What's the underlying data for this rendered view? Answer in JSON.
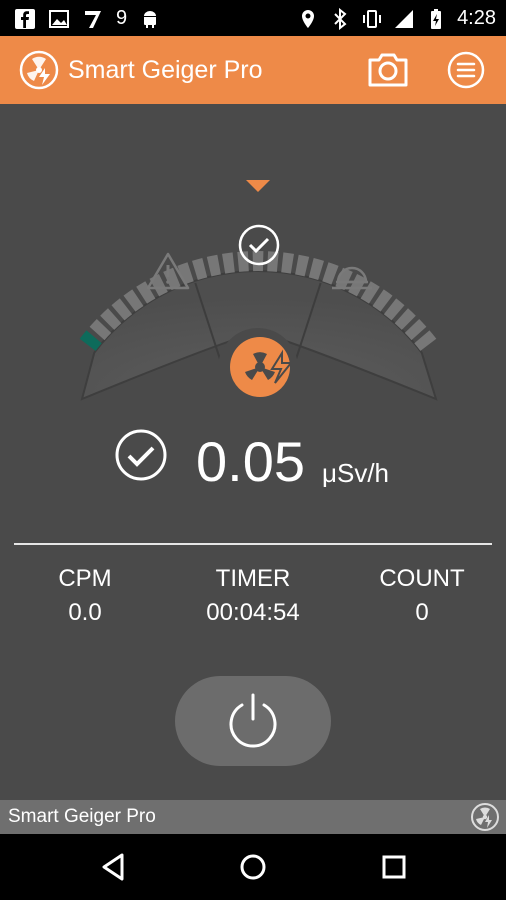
{
  "status_bar": {
    "left_icons": [
      "facebook-icon",
      "image-icon",
      "seven-icon",
      "android-icon"
    ],
    "notification_count": "9",
    "right_icons": [
      "location-icon",
      "bluetooth-icon",
      "vibrate-icon",
      "signal-icon",
      "battery-icon"
    ],
    "time": "4:28"
  },
  "app_bar": {
    "title": "Smart Geiger Pro",
    "actions": [
      "camera-icon",
      "menu-icon"
    ],
    "background": "#ee8a48"
  },
  "gauge": {
    "segments_total": 27,
    "active_segments": 1,
    "active_color": "#0e6b5b",
    "pointer_color": "#ee8a48",
    "zones": [
      "warning-icon",
      "check-icon",
      "alarm-icon"
    ],
    "center_icon": "radiation-icon"
  },
  "dose": {
    "value": "0.05",
    "unit": "μSv/h",
    "status_icon": "check-circle-icon"
  },
  "stats": [
    {
      "label": "CPM",
      "value": "0.0"
    },
    {
      "label": "TIMER",
      "value": "00:04:54"
    },
    {
      "label": "COUNT",
      "value": "0"
    }
  ],
  "power": {
    "icon": "power-icon"
  },
  "footer": {
    "text": "Smart Geiger Pro"
  },
  "nav": [
    "back-icon",
    "home-icon",
    "recents-icon"
  ]
}
